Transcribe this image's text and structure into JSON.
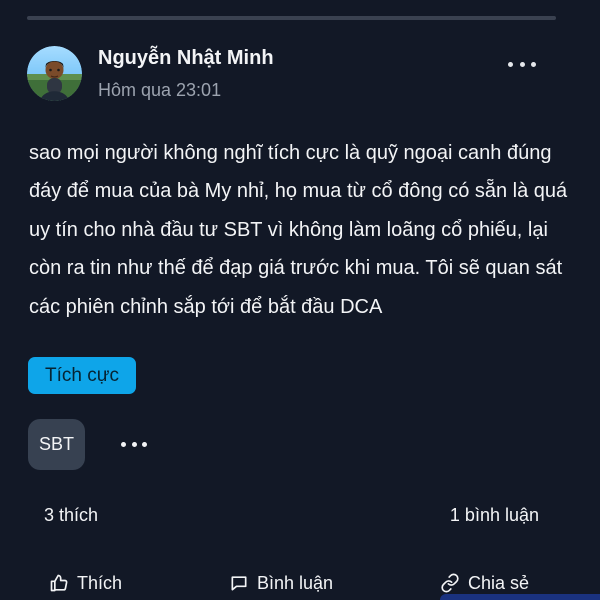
{
  "post": {
    "author_name": "Nguyễn Nhật Minh",
    "time": "Hôm qua 23:01",
    "content": "sao mọi người không nghĩ tích cực là quỹ ngoại canh đúng đáy để mua của bà My nhỉ, họ mua từ cổ đông có sẵn là quá uy tín cho nhà đầu tư SBT vì không làm loãng cổ phiếu, lại còn ra tin như thế để đạp giá trước khi mua. Tôi sẽ quan sát các phiên chỉnh sắp tới để bắt đầu DCA",
    "sentiment": "Tích cực",
    "ticker": "SBT"
  },
  "stats": {
    "likes": "3 thích",
    "comments": "1 bình luận"
  },
  "actions": {
    "like": "Thích",
    "comment": "Bình luận",
    "share": "Chia sẻ"
  },
  "icons": {
    "more": "more-horizontal-icon",
    "like": "thumbs-up-icon",
    "comment": "comment-icon",
    "share": "link-icon"
  },
  "colors": {
    "background": "#121826",
    "badge": "#0ea5e9",
    "chip": "#374151",
    "muted": "#9ca3af",
    "text": "#f3f4f6"
  }
}
